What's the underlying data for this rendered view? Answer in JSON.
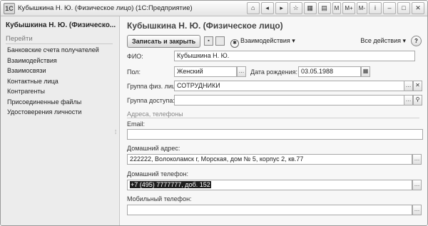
{
  "window": {
    "title": "Кубышкина Н. Ю. (Физическое лицо)  (1С:Предприятие)",
    "buttons": {
      "m": "M",
      "mplus": "M+",
      "mminus": "M-"
    }
  },
  "sidebar": {
    "title": "Кубышкина Н. Ю. (Физическо...",
    "nav_header": "Перейти",
    "items": [
      "Банковские счета получателей",
      "Взаимодействия",
      "Взаимосвязи",
      "Контактные лица",
      "Контрагенты",
      "Присоединенные файлы",
      "Удостоверения личности"
    ]
  },
  "form": {
    "title": "Кубышкина Н. Ю. (Физическое лицо)",
    "toolbar": {
      "save_close": "Записать и закрыть",
      "interactions": "Взаимодействия ▾",
      "all_actions": "Все действия ▾",
      "help": "?"
    },
    "fio_label": "ФИО:",
    "fio_value": "Кубышкина Н. Ю.",
    "gender_label": "Пол:",
    "gender_value": "Женский",
    "birth_label": "Дата рождения:",
    "birth_value": "03.05.1988",
    "group_label": "Группа физ. лиц:",
    "group_value": "СОТРУДНИКИ",
    "access_label": "Группа доступа:",
    "access_value": "",
    "contacts_section": "Адреса, телефоны",
    "email_label": "Email:",
    "email_value": "",
    "home_address_label": "Домашний адрес:",
    "home_address_value": "222222, Волоколамск г, Морская, дом № 5, корпус 2, кв.77",
    "home_phone_label": "Домашний телефон:",
    "home_phone_value": "+7 (495) 7777777, доб. 152",
    "mobile_label": "Мобильный телефон:",
    "mobile_value": ""
  }
}
